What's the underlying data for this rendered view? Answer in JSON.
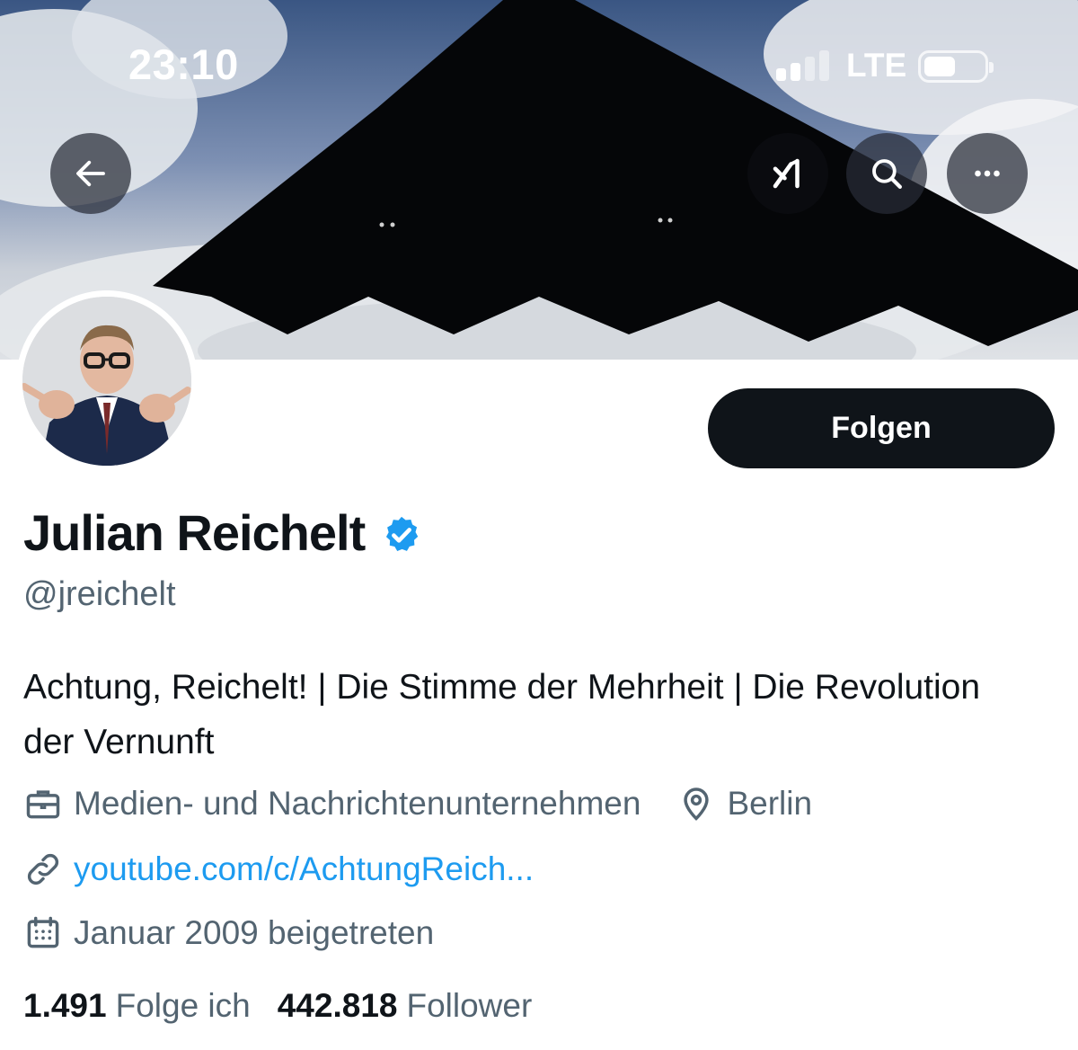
{
  "status_bar": {
    "time": "23:10",
    "network": "LTE",
    "signal_bars": 2,
    "signal_total": 4
  },
  "header": {
    "back_icon": "arrow-left-icon",
    "grok_icon": "grok-icon",
    "search_icon": "search-icon",
    "more_icon": "more-horizontal-icon"
  },
  "profile": {
    "display_name": "Julian Reichelt",
    "handle": "@jreichelt",
    "verified": true,
    "follow_label": "Folgen",
    "bio": "Achtung, Reichelt! | Die Stimme der Mehrheit | Die Revolution der Vernunft",
    "category": "Medien- und Nachrichtenunternehmen",
    "location": "Berlin",
    "website": "youtube.com/c/AchtungReich...",
    "joined": "Januar 2009 beigetreten",
    "following_count": "1.491",
    "following_label": "Folge ich",
    "followers_count": "442.818",
    "followers_label": "Follower"
  },
  "colors": {
    "accent": "#1d9bf0",
    "text_primary": "#0f1419",
    "text_secondary": "#536471",
    "button_bg": "#0f1419"
  }
}
